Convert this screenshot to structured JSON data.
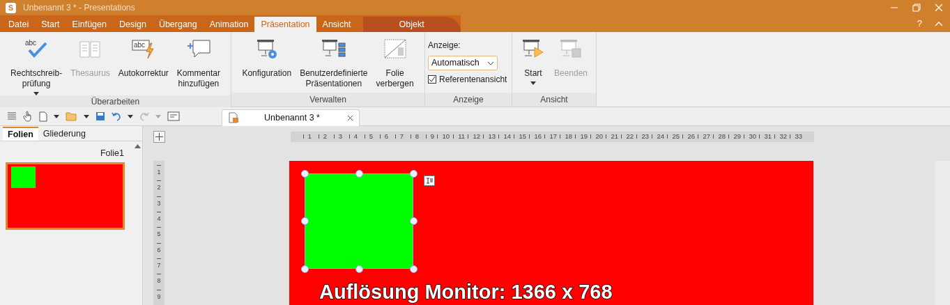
{
  "window": {
    "title": "Unbenannt 3 * - Presentations",
    "app_letter": "S"
  },
  "menu_tabs": [
    {
      "label": "Datei",
      "selected": false
    },
    {
      "label": "Start",
      "selected": false
    },
    {
      "label": "Einfügen",
      "selected": false
    },
    {
      "label": "Design",
      "selected": false
    },
    {
      "label": "Übergang",
      "selected": false
    },
    {
      "label": "Animation",
      "selected": false
    },
    {
      "label": "Präsentation",
      "selected": true
    },
    {
      "label": "Ansicht",
      "selected": false
    }
  ],
  "context_tab": {
    "label": "Objekt"
  },
  "help": "?",
  "ribbon_groups": [
    {
      "label": "Überarbeiten",
      "buttons": [
        {
          "lines": [
            "Rechtschreib-",
            "prüfung"
          ],
          "icon_text": "abc",
          "disabled": false,
          "has_menu": true
        },
        {
          "lines": [
            "Thesaurus"
          ],
          "disabled": true,
          "has_menu": false
        },
        {
          "lines": [
            "Autokorrektur"
          ],
          "icon_text": "abc",
          "disabled": false,
          "has_menu": false
        },
        {
          "lines": [
            "Kommentar",
            "hinzufügen"
          ],
          "disabled": false,
          "has_menu": false
        }
      ]
    },
    {
      "label": "Verwalten",
      "buttons": [
        {
          "lines": [
            "Konfiguration"
          ],
          "disabled": false,
          "has_menu": false
        },
        {
          "lines": [
            "Benutzerdefinierte",
            "Präsentationen"
          ],
          "disabled": false,
          "has_menu": false
        },
        {
          "lines": [
            "Folie",
            "verbergen"
          ],
          "disabled": false,
          "has_menu": false
        }
      ]
    },
    {
      "label": "Anzeige",
      "display": {
        "label": "Anzeige:",
        "value": "Automatisch",
        "checkbox": {
          "label": "Referentenansicht",
          "checked": true
        }
      }
    },
    {
      "label": "Ansicht",
      "buttons": [
        {
          "lines": [
            "Start"
          ],
          "disabled": false,
          "has_menu": true
        },
        {
          "lines": [
            "Beenden"
          ],
          "disabled": true,
          "has_menu": false
        }
      ]
    }
  ],
  "document_tab": {
    "title": "Unbenannt 3 *"
  },
  "sidebar": {
    "tabs": [
      {
        "label": "Folien",
        "selected": true
      },
      {
        "label": "Gliederung",
        "selected": false
      }
    ],
    "slides": [
      {
        "label": "Folie1",
        "selected": true
      }
    ]
  },
  "rulers": {
    "horizontal": [
      "1",
      "2",
      "3",
      "4",
      "5",
      "6",
      "7",
      "8",
      "9",
      "10",
      "11",
      "12",
      "13",
      "14",
      "15",
      "16",
      "17",
      "18",
      "19",
      "20",
      "21",
      "22",
      "23",
      "24",
      "25",
      "26",
      "27",
      "28",
      "29",
      "30",
      "31",
      "32",
      "33"
    ],
    "vertical": [
      "1",
      "2",
      "3",
      "4",
      "5",
      "6",
      "7",
      "8",
      "9"
    ]
  },
  "slide": {
    "caption": "Auflösung Monitor: 1366 x 768"
  }
}
